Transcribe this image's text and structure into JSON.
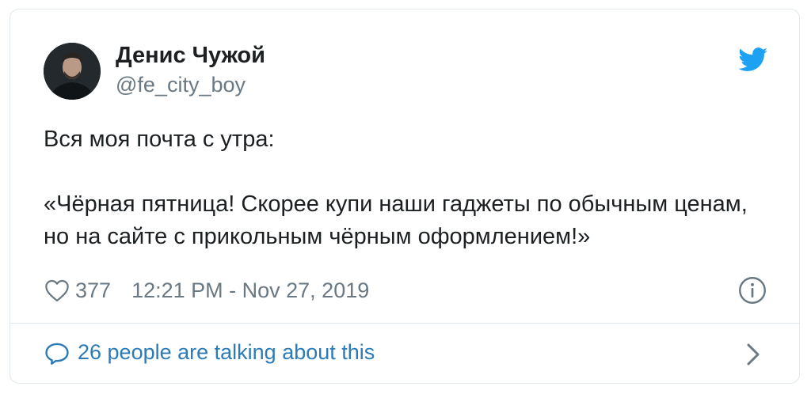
{
  "tweet": {
    "author_name": "Денис Чужой",
    "author_handle": "@fe_city_boy",
    "text_line1": "Вся моя почта с утра:",
    "text_line2": "«Чёрная пятница! Скорее купи наши гаджеты по обычным ценам, но на сайте с прикольным чёрным оформлением!»",
    "likes": "377",
    "timestamp": "12:21 PM - Nov 27, 2019",
    "talking_label": "26 people are talking about this"
  },
  "icons": {
    "brand": "twitter-bird-icon",
    "like": "heart-icon",
    "info": "info-icon",
    "comment": "speech-bubble-icon",
    "chevron": "chevron-right-icon"
  },
  "colors": {
    "text": "#1c2022",
    "secondary": "#697882",
    "link": "#2b7bb9",
    "twitter_blue": "#1da1f2",
    "border": "#e1e8ed"
  }
}
